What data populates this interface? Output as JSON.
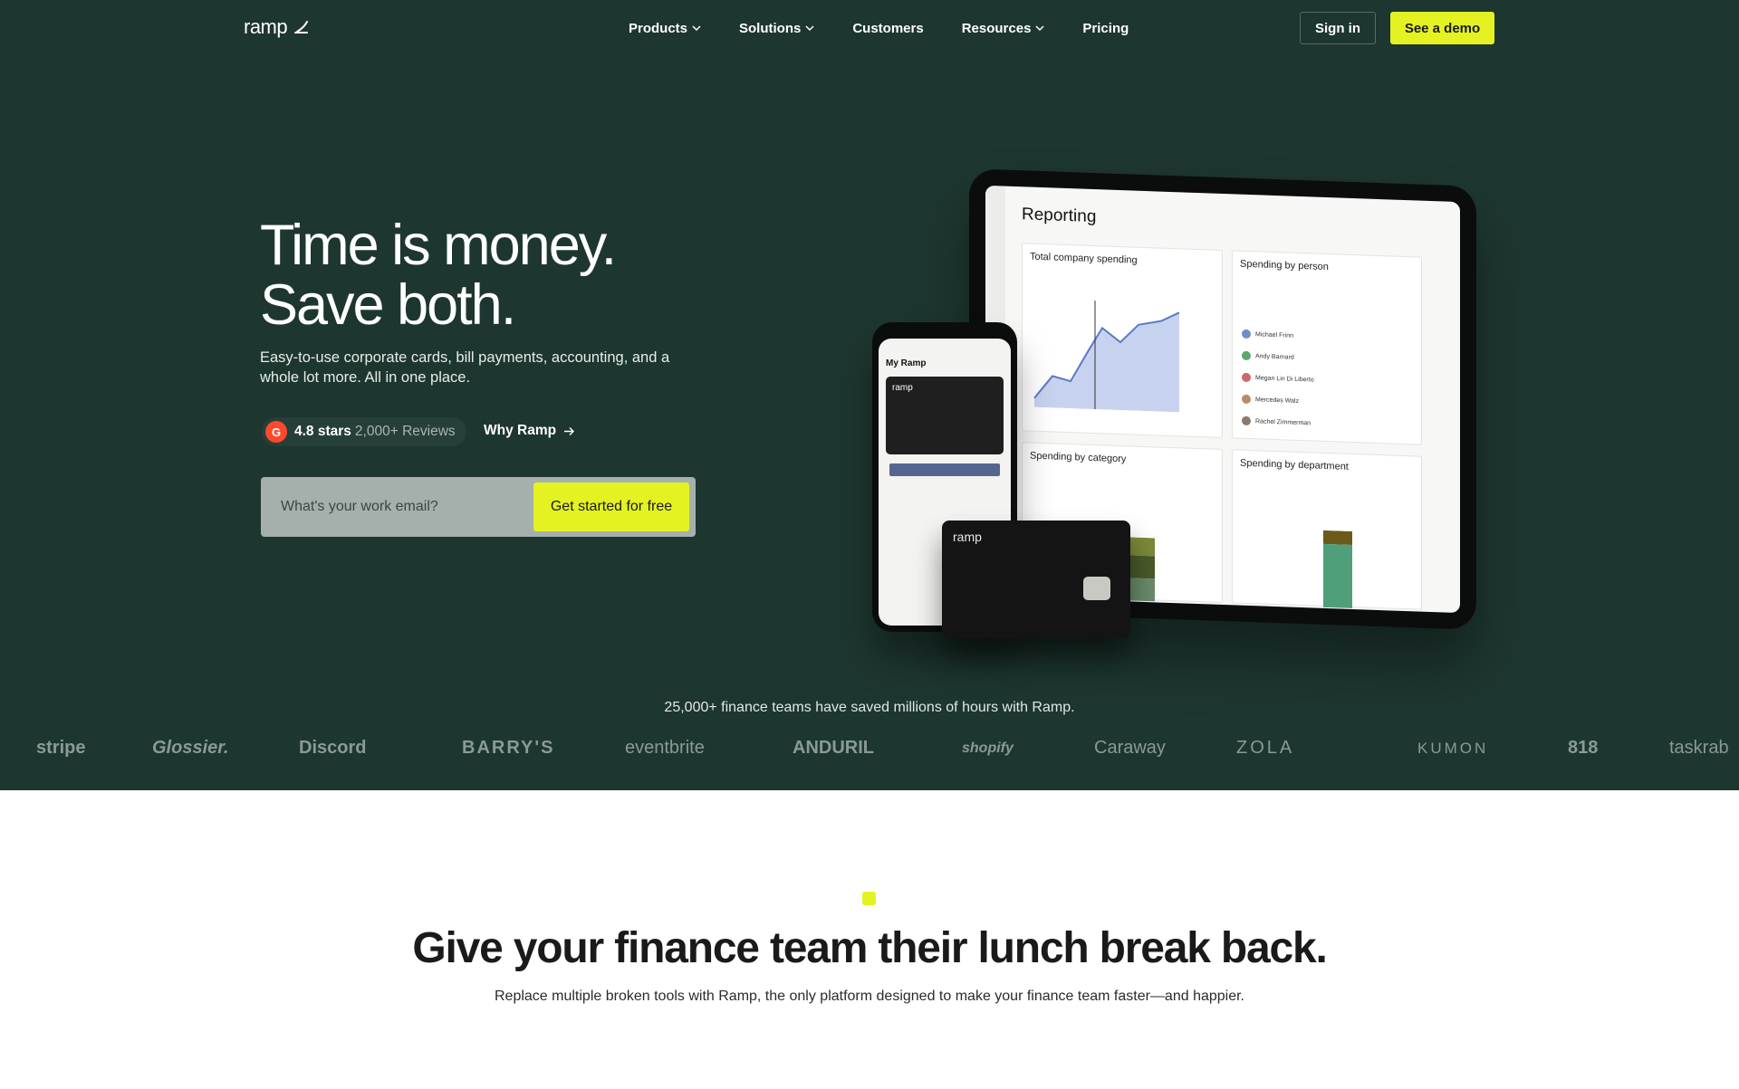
{
  "nav": {
    "logo_text": "ramp",
    "links": [
      {
        "label": "Products",
        "dropdown": true
      },
      {
        "label": "Solutions",
        "dropdown": true
      },
      {
        "label": "Customers",
        "dropdown": false
      },
      {
        "label": "Resources",
        "dropdown": true
      },
      {
        "label": "Pricing",
        "dropdown": false
      }
    ],
    "signin_label": "Sign in",
    "demo_label": "See a demo"
  },
  "hero": {
    "headline_line1": "Time is money.",
    "headline_line2": "Save both.",
    "subcopy": "Easy-to-use corporate cards, bill payments, accounting, and a whole lot more. All in one place.",
    "rating_badge": "G",
    "rating_stars": "4.8 stars",
    "rating_reviews": "2,000+ Reviews",
    "why_label": "Why Ramp",
    "email_placeholder": "What's your work email?",
    "cta_label": "Get started for free"
  },
  "devices": {
    "tablet_title": "Reporting",
    "panel_total": "Total company spending",
    "panel_person": "Spending by person",
    "panel_category": "Spending by category",
    "panel_department": "Spending by department",
    "people": [
      "Michael Frinn",
      "Andy Barnard",
      "Megan Lin Di Liberto",
      "Mercedes Walz",
      "Rachel Zimmerman"
    ],
    "phone_title": "My Ramp",
    "phone_card_text": "ramp",
    "card_text": "ramp"
  },
  "social_proof": {
    "tagline": "25,000+ finance teams have saved millions of hours with Ramp.",
    "brands": [
      "stripe",
      "Glossier.",
      "Discord",
      "BARRY'S",
      "eventbrite",
      "ANDURIL",
      "shopify",
      "Caraway",
      "ZOLA",
      "KUMON",
      "818",
      "taskrab"
    ]
  },
  "section2": {
    "title": "Give your finance team their lunch break back.",
    "subtitle": "Replace multiple broken tools with Ramp, the only platform designed to make your finance team faster—and happier."
  },
  "colors": {
    "hero_bg": "#1e3630",
    "accent": "#e4f222"
  }
}
